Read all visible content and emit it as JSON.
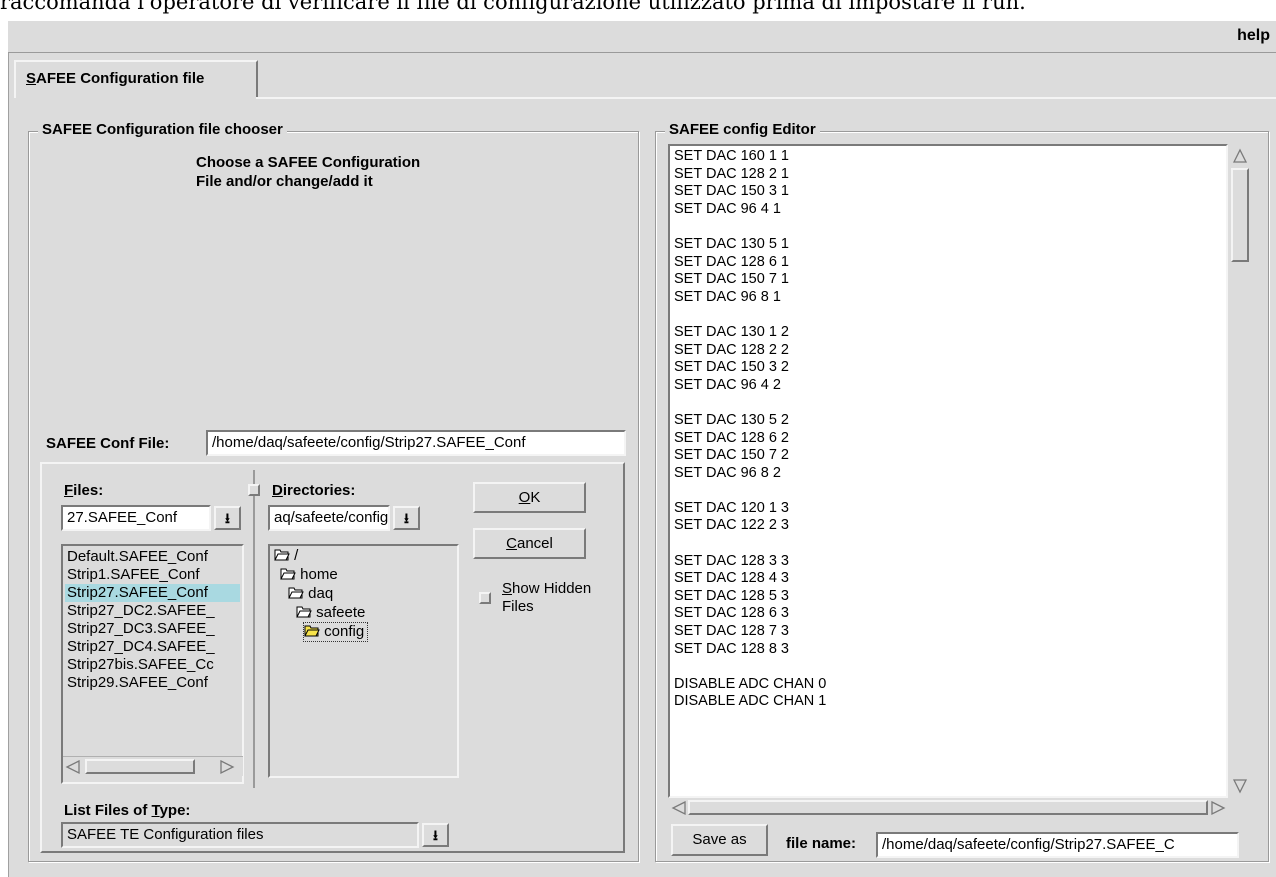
{
  "caption": "raccomanda l'operatore di verificare il file di configurazione utilizzato prima di impostare il run.",
  "menu": {
    "help": "help"
  },
  "tab": {
    "first_letter": "S",
    "rest": "AFEE Configuration file"
  },
  "chooser": {
    "legend": "SAFEE Configuration file chooser",
    "instructions_line1": "Choose a SAFEE Configuration",
    "instructions_line2": "File and/or change/add it",
    "conf_file_label": "SAFEE Conf File:",
    "conf_file_value": "/home/daq/safeete/config/Strip27.SAFEE_Conf",
    "files": {
      "label_first": "F",
      "label_rest": "iles:",
      "filter_value": "27.SAFEE_Conf",
      "items": [
        "Default.SAFEE_Conf",
        "Strip1.SAFEE_Conf",
        "Strip27.SAFEE_Conf",
        "Strip27_DC2.SAFEE_",
        "Strip27_DC3.SAFEE_",
        "Strip27_DC4.SAFEE_",
        "Strip27bis.SAFEE_Cc",
        "Strip29.SAFEE_Conf"
      ],
      "selected_index": 2
    },
    "directories": {
      "label_first": "D",
      "label_rest": "irectories:",
      "filter_value": "aq/safeete/config",
      "items": [
        "/",
        "home",
        "daq",
        "safeete",
        "config"
      ]
    },
    "ok_first": "O",
    "ok_rest": "K",
    "cancel_first": "C",
    "cancel_rest": "ancel",
    "show_hidden_first": "S",
    "show_hidden_rest": "how Hidden",
    "show_hidden_line2": "Files",
    "filetype_label_pre": "List Files of ",
    "filetype_label_u": "T",
    "filetype_label_post": "ype:",
    "filetype_value": "SAFEE TE Configuration files"
  },
  "editor": {
    "legend": "SAFEE config Editor",
    "lines": [
      "SET DAC 160 1 1",
      "SET DAC 128 2 1",
      "SET DAC 150 3 1",
      "SET DAC 96 4 1",
      "",
      "SET DAC 130 5 1",
      "SET DAC 128 6 1",
      "SET DAC 150 7 1",
      "SET DAC 96 8 1",
      "",
      "SET DAC 130 1 2",
      "SET DAC 128 2 2",
      "SET DAC 150 3 2",
      "SET DAC 96 4 2",
      "",
      "SET DAC 130 5 2",
      "SET DAC 128 6 2",
      "SET DAC 150 7 2",
      "SET DAC 96 8 2",
      "",
      "SET DAC 120 1 3",
      "SET DAC 122 2 3",
      "",
      "SET DAC 128 3 3",
      "SET DAC 128 4 3",
      "SET DAC 128 5 3",
      "SET DAC 128 6 3",
      "SET DAC 128 7 3",
      "SET DAC 128 8 3",
      "",
      "DISABLE ADC CHAN 0",
      "DISABLE ADC CHAN 1"
    ],
    "save_as": "Save as",
    "file_name_label": "file name:",
    "file_name_value": "/home/daq/safeete/config/Strip27.SAFEE_C"
  }
}
